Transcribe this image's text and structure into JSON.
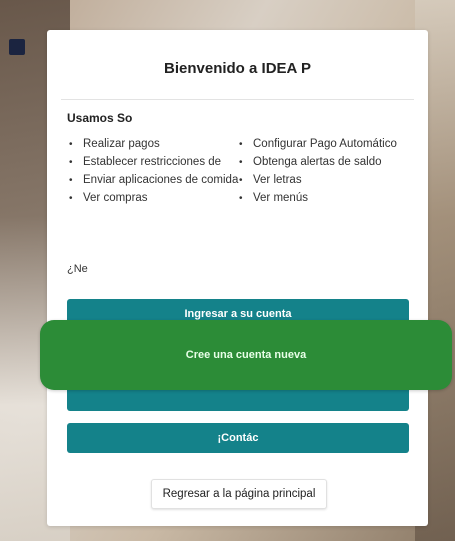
{
  "welcome": {
    "title": "Bienvenido a IDEA P"
  },
  "uses": {
    "title": "Usamos So",
    "features_left": [
      "Realizar pagos",
      "Establecer restricciones de",
      "Enviar aplicaciones de comida",
      "Ver compras"
    ],
    "features_right": [
      "Configurar Pago Automático",
      "Obtenga alertas de saldo",
      "Ver letras",
      "Ver menús"
    ]
  },
  "question": "¿Ne",
  "buttons": {
    "login": "Ingresar a su cuenta",
    "create": "Cree una cuenta nueva",
    "contact": "¡Contác"
  },
  "back": {
    "label": "Regresar a la página principal"
  },
  "colors": {
    "primary_teal": "#14828a",
    "create_green": "#2c8c37",
    "accent_orange": "#e3510f"
  }
}
